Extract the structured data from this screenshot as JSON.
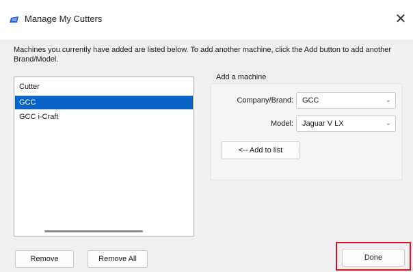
{
  "window": {
    "title": "Manage My Cutters",
    "close_glyph": "✕"
  },
  "instructions": "Machines you currently have added are listed below. To add another machine, click the Add button to add another Brand/Model.",
  "cutter_list": {
    "header": "Cutter",
    "items": [
      {
        "label": "GCC",
        "selected": true
      },
      {
        "label": "GCC i-Craft",
        "selected": false
      }
    ]
  },
  "add_machine": {
    "group_label": "Add a machine",
    "company_label": "Company/Brand:",
    "company_value": "GCC",
    "model_label": "Model:",
    "model_value": "Jaguar V LX",
    "add_button": "<-- Add to list"
  },
  "buttons": {
    "remove": "Remove",
    "remove_all": "Remove All",
    "done": "Done"
  },
  "colors": {
    "selection": "#0a64c8",
    "highlight_border": "#e0141e",
    "icon": "#2a5bd7"
  },
  "icons": {
    "app": "cutter-app-icon",
    "close": "close-icon",
    "dropdown": "chevron-down-icon"
  }
}
